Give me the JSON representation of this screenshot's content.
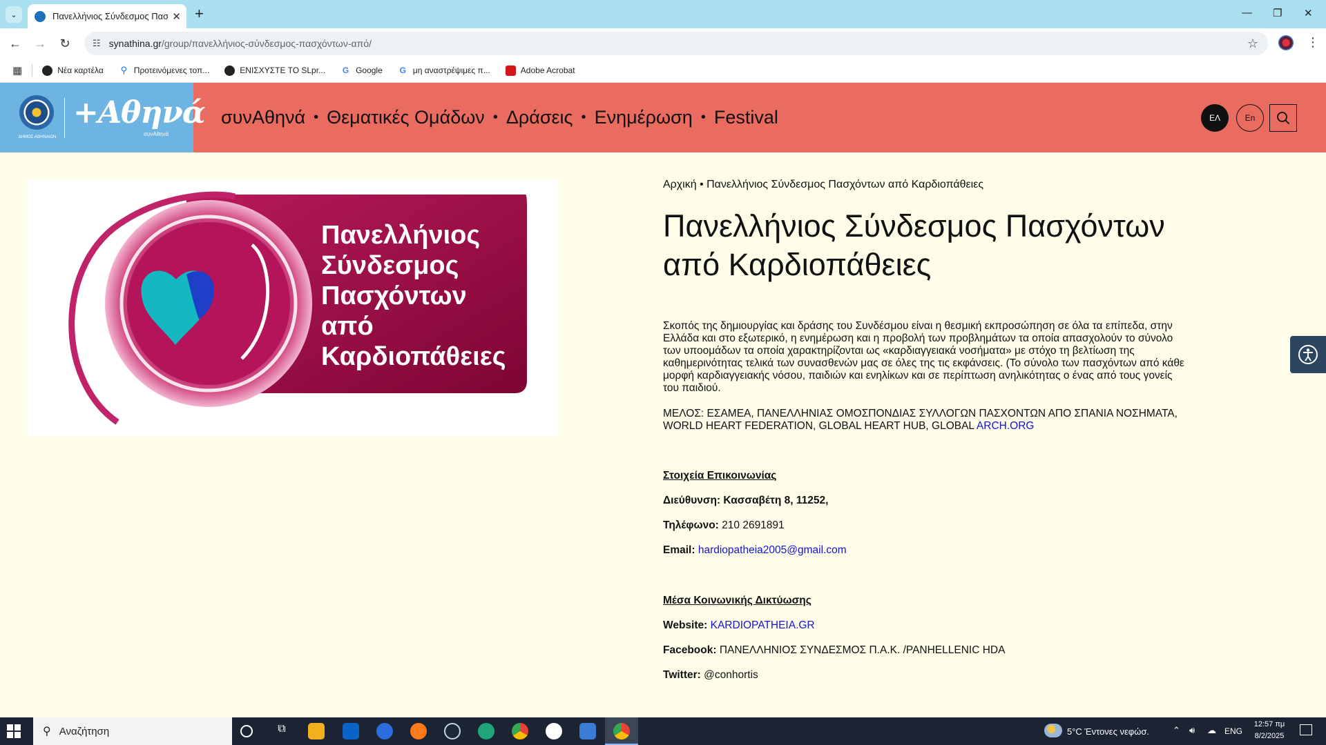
{
  "browser": {
    "tab_title": "Πανελλήνιος Σύνδεσμος Πασχ...",
    "url_host": "synathina.gr",
    "url_path": "/group/πανελλήνιος-σύνδεσμος-πασχόντων-από/",
    "bookmarks": [
      {
        "label": "Νέα καρτέλα"
      },
      {
        "label": "Προτεινόμενες τοπ..."
      },
      {
        "label": "ΕΝΙΣΧΥΣΤΕ ΤΟ SLpr..."
      },
      {
        "label": "Google"
      },
      {
        "label": "μη αναστρέψιμες π..."
      },
      {
        "label": "Adobe Acrobat"
      }
    ]
  },
  "header": {
    "logo_text": "+Αθηνά",
    "logo_sub": "συνΑθηνά",
    "seal_caption": "ΔΗΜΟΣ ΑΘΗΝΑΙΩΝ",
    "nav": [
      "συνΑθηνά",
      "Θεματικές Ομάδων",
      "Δράσεις",
      "Ενημέρωση",
      "Festival"
    ],
    "nav_separator": "•",
    "lang_el": "ΕΛ",
    "lang_en": "En"
  },
  "hero": {
    "logo_lines": [
      "Πανελλήνιος",
      "Σύνδεσμος",
      "Πασχόντων",
      "από",
      "Καρδιοπάθειες"
    ]
  },
  "page": {
    "breadcrumb": "Αρχική • Πανελλήνιος Σύνδεσμος Πασχόντων από Καρδιοπάθειες",
    "title_line1": "Πανελλήνιος Σύνδεσμος Πασχόντων",
    "title_line2": "από Καρδιοπάθειες",
    "description": "Σκοπός της δημιουργίας και δράσης του Συνδέσμου είναι η θεσμική εκπροσώπηση σε όλα τα επίπεδα, στην Ελλάδα και στο εξωτερικό, η ενημέρωση και η προβολή των προβλημάτων τα οποία απασχολούν το σύνολο των υποομάδων τα οποία χαρακτηρίζονται ως «καρδιαγγειακά νοσήματα» με στόχο τη βελτίωση της καθημερινότητας τελικά των συνασθενών μας σε όλες της τις εκφάνσεις. (Το σύνολο των πασχόντων από κάθε μορφή καρδιαγγειακής νόσου, παιδιών και ενηλίκων  και σε περίπτωση ανηλικότητας ο ένας από τους γονείς του παιδιού.",
    "members_text": "ΜΕΛΟΣ: ΕΣΑΜΕΑ, ΠΑΝΕΛΛΗΝΙΑΣ ΟΜΟΣΠΟΝΔΙΑΣ ΣΥΛΛΟΓΩΝ ΠΑΣΧΟΝΤΩΝ ΑΠΟ ΣΠΑΝΙΑ ΝΟΣΗΜΑΤΑ, WORLD HEART FEDERATION, GLOBAL HEART HUB, GLOBAL ",
    "members_link": "ARCH.ORG",
    "contact_heading": "Στοιχεία Επικοινωνίας",
    "address_label": "Διεύθυνση:",
    "address_value": "Κασσαβέτη 8, 11252,",
    "phone_label": "Τηλέφωνο:",
    "phone_value": "210 2691891",
    "email_label": "Email:",
    "email_value": "hardiopatheia2005@gmail.com",
    "social_heading": "Μέσα Κοινωνικής Δικτύωσης",
    "website_label": "Website:",
    "website_value": "KARDIOPATHEIA.GR",
    "facebook_label": "Facebook:",
    "facebook_value": "ΠΑΝΕΛΛΗΝΙΟΣ ΣΥΝΔΕΣΜΟΣ Π.Α.Κ. /PANHELLENIC HDA",
    "twitter_label": "Twitter:",
    "twitter_value": "@conhortis"
  },
  "taskbar": {
    "search_placeholder": "Αναζήτηση",
    "weather": "5°C  Έντονες νεφώσ.",
    "lang": "ENG",
    "time": "12:57 πμ",
    "date": "8/2/2025"
  },
  "colors": {
    "header_bg": "#ea6b5f",
    "logo_bg": "#6eb4e2",
    "page_bg": "#fdfdea",
    "link": "#1414d0",
    "hero_magenta": "#a8104f"
  }
}
